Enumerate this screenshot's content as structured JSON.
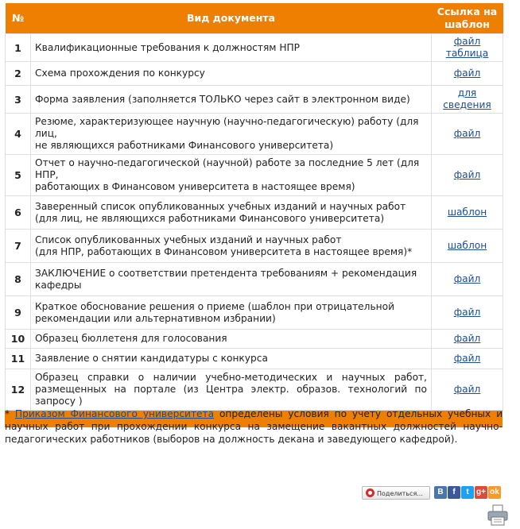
{
  "table": {
    "headers": {
      "num": "№",
      "doc": "Вид документа",
      "link_line1": "Ссылка на",
      "link_line2": "шаблон"
    },
    "rows": [
      {
        "num": "1",
        "lines": [
          "Квалификационные требования к должностям НПР"
        ],
        "links": [
          "файл",
          "таблица"
        ]
      },
      {
        "num": "2",
        "lines": [
          "Схема прохождения по конкурсу"
        ],
        "links": [
          "файл"
        ]
      },
      {
        "num": "3",
        "lines": [
          "Форма заявления (заполняется ТОЛЬКО через сайт в электронном виде)"
        ],
        "links": [
          "для сведения"
        ]
      },
      {
        "num": "4",
        "lines": [
          "Резюме, характеризующее научную (научно-педагогическую) работу (для лиц,",
          "не являющихся работниками Финансового университета)"
        ],
        "links": [
          "файл"
        ]
      },
      {
        "num": "5",
        "lines": [
          "Отчет о научно-педагогической (научной) работе за последние 5 лет  (для НПР,",
          "работающих в Финансовом университета в настоящее время)"
        ],
        "links": [
          "файл"
        ]
      },
      {
        "num": "6",
        "lines": [
          "Заверенный список опубликованных учебных изданий и научных работ",
          "(для лиц, не являющихся работниками Финансового университета)"
        ],
        "links": [
          "шаблон"
        ]
      },
      {
        "num": "7",
        "lines": [
          "Список опубликованных учебных изданий и научных работ",
          "(для НПР, работающих в Финансовом университета в настоящее время)*"
        ],
        "links": [
          "шаблон"
        ]
      },
      {
        "num": "8",
        "lines": [
          "ЗАКЛЮЧЕНИЕ о соответствии претендента требованиям + рекомендация",
          "кафедры"
        ],
        "links": [
          "файл"
        ]
      },
      {
        "num": "9",
        "lines": [
          "Краткое обоснование решения о приеме (шаблон при отрицательной",
          "рекомендации или альтернативном избрании)"
        ],
        "links": [
          "файл"
        ]
      },
      {
        "num": "10",
        "lines": [
          "Образец бюллетеня для голосования"
        ],
        "links": [
          "файл"
        ]
      },
      {
        "num": "11",
        "lines": [
          "Заявление о снятии кандидатуры с конкурса"
        ],
        "links": [
          "файл"
        ]
      },
      {
        "num": "12",
        "lines": [
          "Образец справки о наличии учебно-методических и научных работ,",
          "размещенных на портале (из Центра электр. образов. технологий по запросу )"
        ],
        "links": [
          "файл"
        ]
      }
    ]
  },
  "note": {
    "prefix": "* ",
    "link": "Приказом Финансового университета",
    "text": " определены условия по учету отдельных учебных и научных работ при прохождении конкурса на замещение вакантных должностей научно-педагогических работников (выборов на должность декана и заведующего кафедрой)."
  },
  "share": {
    "label": "Поделиться...",
    "networks": [
      {
        "name": "vkontakte-icon",
        "glyph": "B",
        "color": "#4a76a8"
      },
      {
        "name": "facebook-icon",
        "glyph": "f",
        "color": "#3b5998"
      },
      {
        "name": "twitter-icon",
        "glyph": "t",
        "color": "#1da1f2"
      },
      {
        "name": "google-plus-icon",
        "glyph": "g+",
        "color": "#dd4b39"
      },
      {
        "name": "odnoklassniki-icon",
        "glyph": "ok",
        "color": "#f59a2b"
      }
    ]
  },
  "colors": {
    "accent": "#ee7f00",
    "link": "#1a4d97"
  }
}
